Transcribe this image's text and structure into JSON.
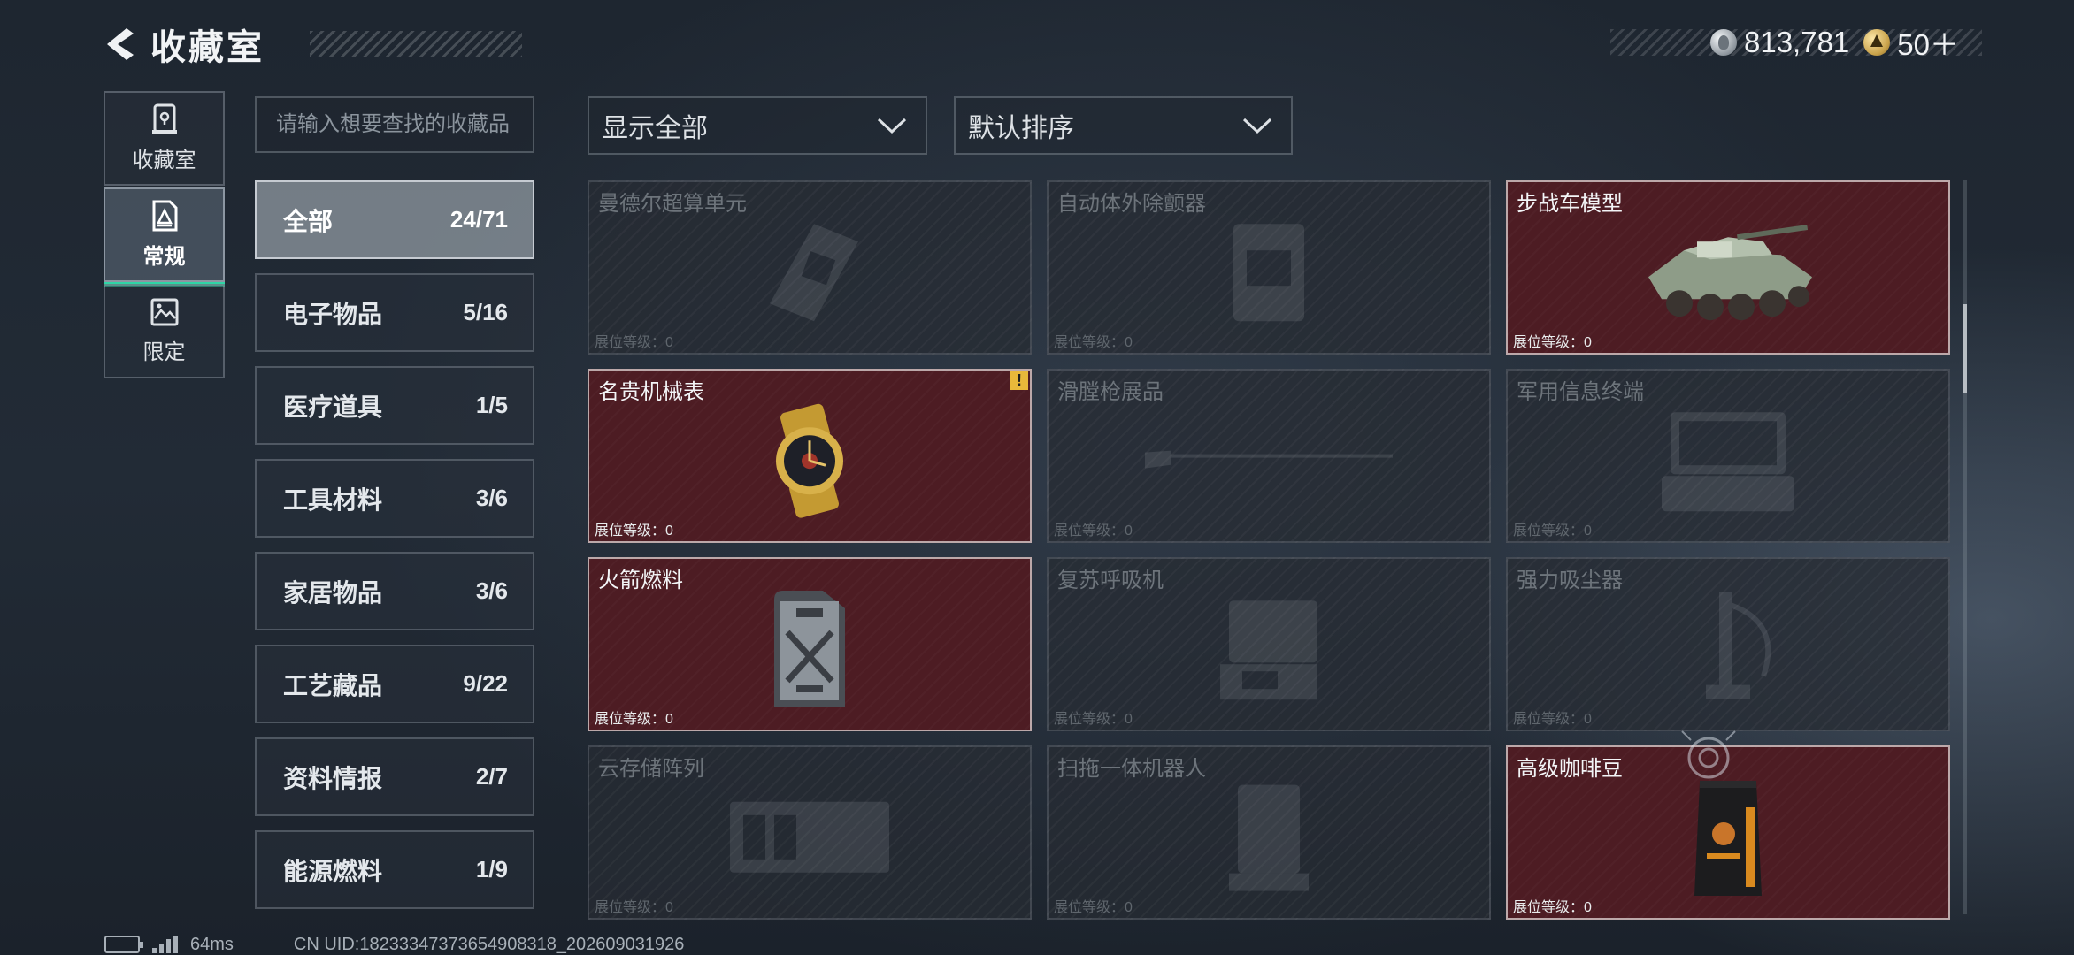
{
  "header": {
    "title": "收藏室",
    "back_icon": "back-arrow-icon"
  },
  "currency": [
    {
      "icon": "silver-coin-icon",
      "value": "813,781"
    },
    {
      "icon": "gold-coin-icon",
      "value": "50＋"
    }
  ],
  "nav": [
    {
      "label": "收藏室",
      "icon": "vault-icon",
      "active": false
    },
    {
      "label": "常规",
      "icon": "document-icon",
      "active": true
    },
    {
      "label": "限定",
      "icon": "image-icon",
      "active": false
    }
  ],
  "search": {
    "placeholder": "请输入想要查找的收藏品",
    "value": ""
  },
  "categories": [
    {
      "label": "全部",
      "count": "24/71",
      "active": true
    },
    {
      "label": "电子物品",
      "count": "5/16"
    },
    {
      "label": "医疗道具",
      "count": "1/5"
    },
    {
      "label": "工具材料",
      "count": "3/6"
    },
    {
      "label": "家居物品",
      "count": "3/6"
    },
    {
      "label": "工艺藏品",
      "count": "9/22"
    },
    {
      "label": "资料情报",
      "count": "2/7"
    },
    {
      "label": "能源燃料",
      "count": "1/9"
    }
  ],
  "filter": {
    "selected": "显示全部"
  },
  "sort": {
    "selected": "默认排序"
  },
  "level_label": "展位等级：0",
  "alert_mark": "!",
  "items": [
    {
      "name": "曼德尔超算单元",
      "owned": false,
      "icon": "computer-board-icon"
    },
    {
      "name": "自动体外除颤器",
      "owned": false,
      "icon": "defibrillator-icon"
    },
    {
      "name": "步战车模型",
      "owned": true,
      "icon": "armored-vehicle-model-icon"
    },
    {
      "name": "名贵机械表",
      "owned": true,
      "icon": "luxury-watch-icon",
      "alert": true
    },
    {
      "name": "滑膛枪展品",
      "owned": false,
      "icon": "musket-icon"
    },
    {
      "name": "军用信息终端",
      "owned": false,
      "icon": "rugged-laptop-icon"
    },
    {
      "name": "火箭燃料",
      "owned": true,
      "icon": "fuel-canister-icon"
    },
    {
      "name": "复苏呼吸机",
      "owned": false,
      "icon": "ventilator-icon"
    },
    {
      "name": "强力吸尘器",
      "owned": false,
      "icon": "vacuum-cleaner-icon"
    },
    {
      "name": "云存储阵列",
      "owned": false,
      "icon": "server-array-icon"
    },
    {
      "name": "扫拖一体机器人",
      "owned": false,
      "icon": "robot-cleaner-icon"
    },
    {
      "name": "高级咖啡豆",
      "owned": true,
      "icon": "coffee-bag-icon"
    }
  ],
  "footer": {
    "ping": "64ms",
    "uid": "CN UID:18233347373654908318_202609031926"
  },
  "colors": {
    "accent": "#2fd5a6",
    "owned_card": "#4d1c23",
    "alert": "#e8b93a"
  }
}
